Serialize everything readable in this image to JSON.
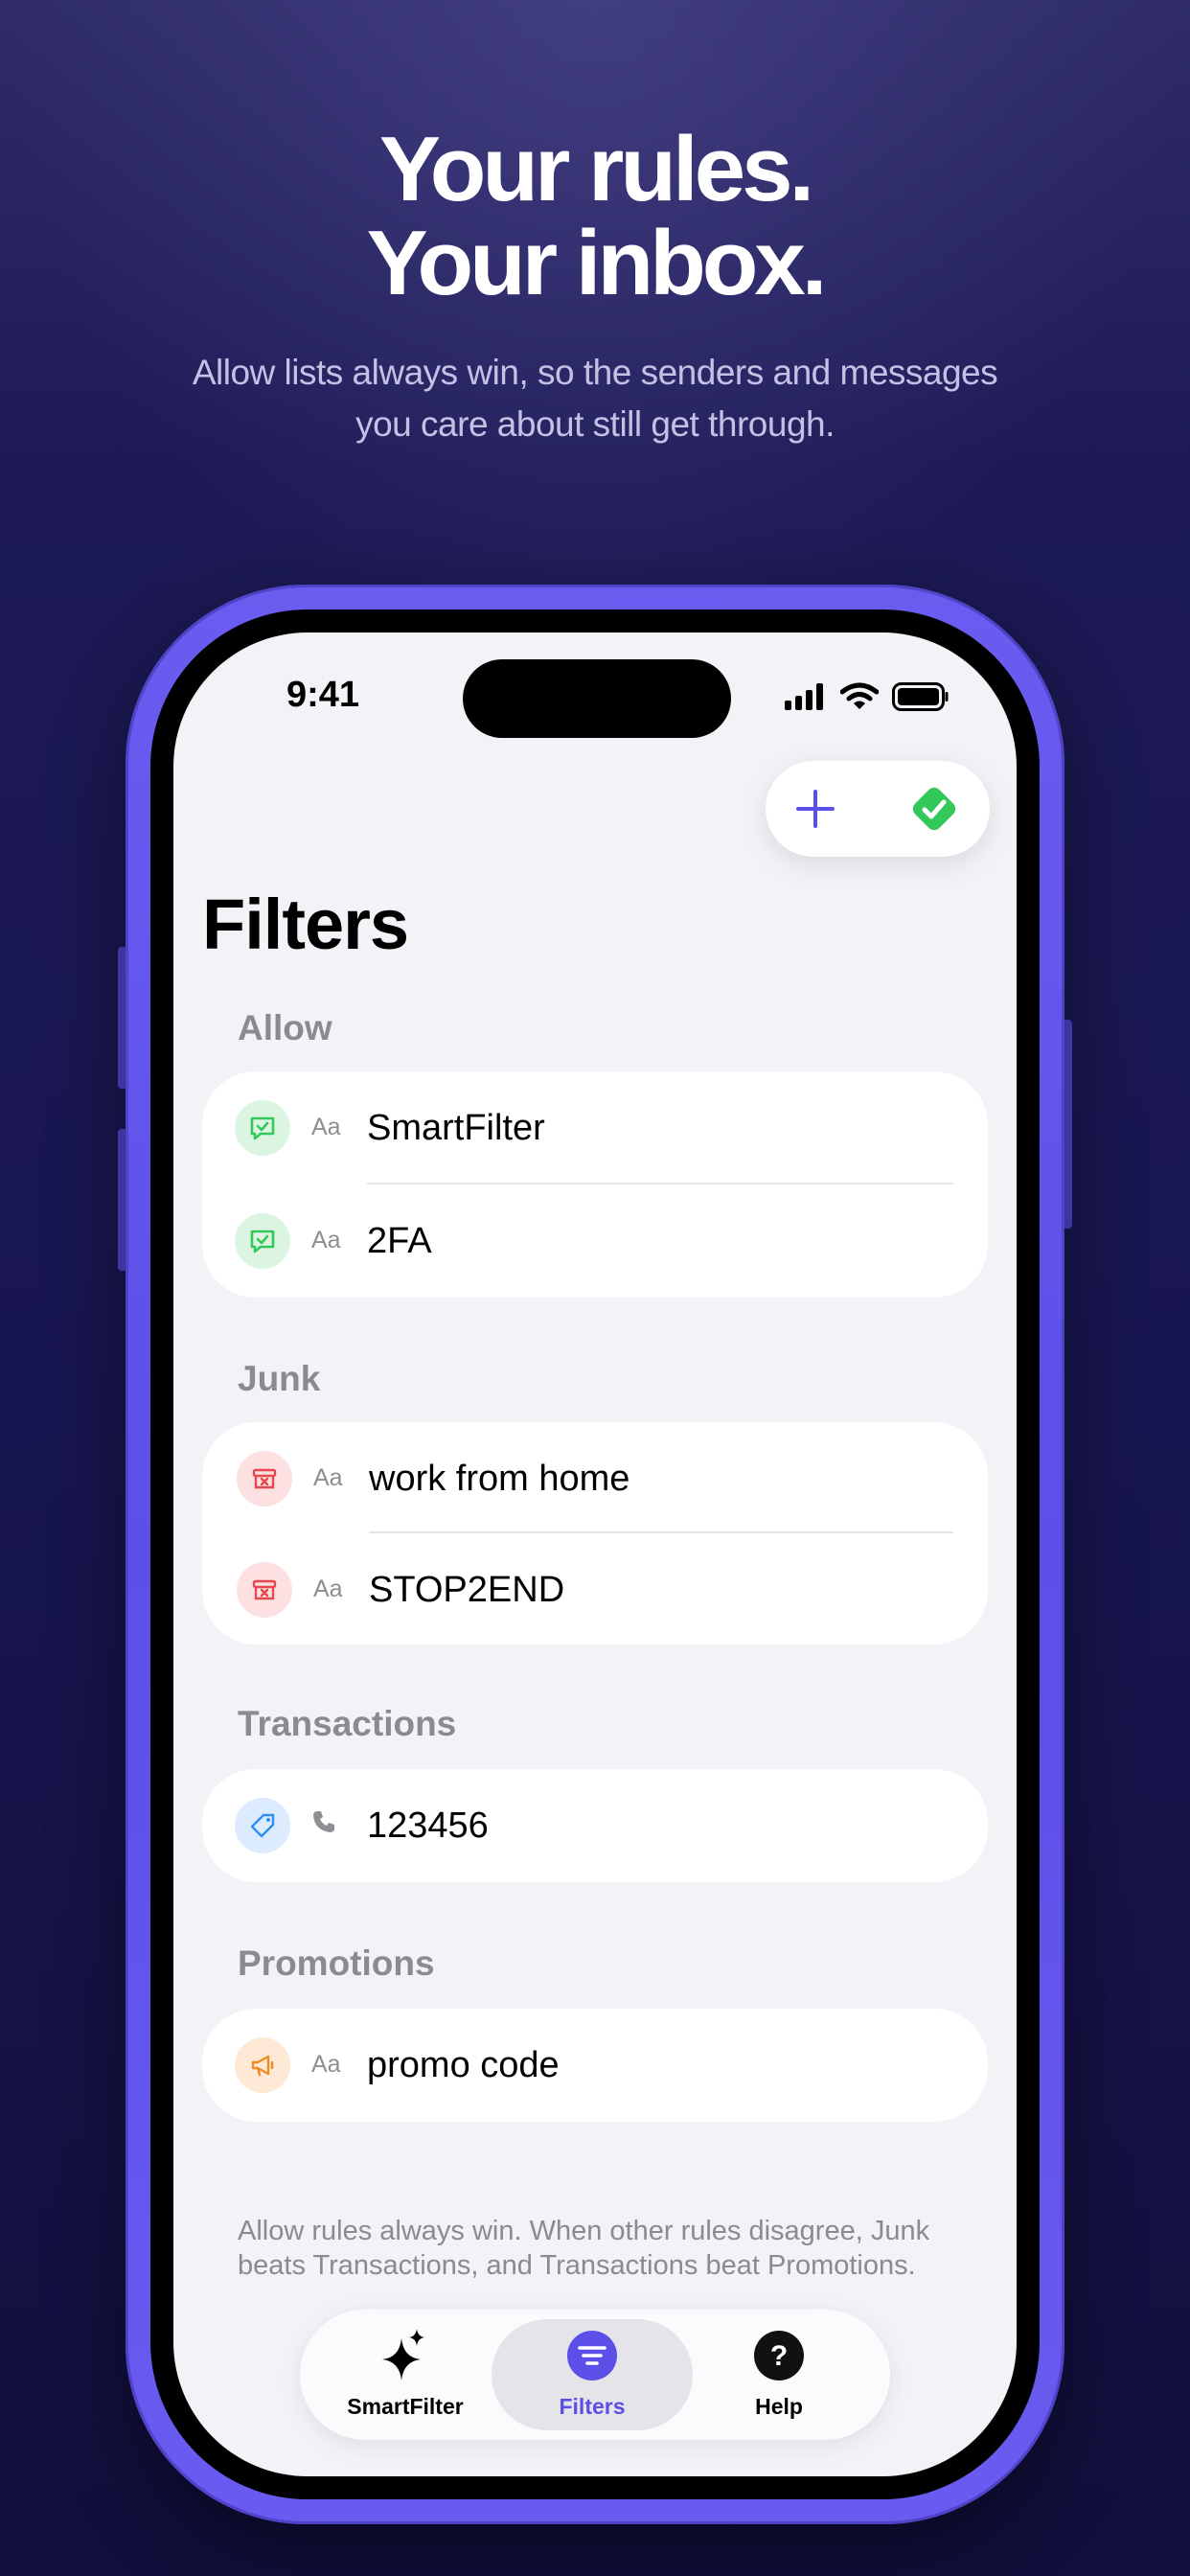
{
  "marketing": {
    "headline_line1": "Your rules.",
    "headline_line2": "Your inbox.",
    "subhead": "Allow lists always win, so the senders and messages you care about still get through."
  },
  "status_bar": {
    "time": "9:41"
  },
  "toolbar": {
    "add_icon": "plus-icon",
    "confirm_icon": "checkmark-diamond-icon"
  },
  "page": {
    "title": "Filters"
  },
  "sections": {
    "allow": {
      "label": "Allow",
      "rows": [
        {
          "type_label": "Aa",
          "text": "SmartFilter",
          "icon": "message-check-icon"
        },
        {
          "type_label": "Aa",
          "text": "2FA",
          "icon": "message-check-icon"
        }
      ]
    },
    "junk": {
      "label": "Junk",
      "rows": [
        {
          "type_label": "Aa",
          "text": "work from home",
          "icon": "archive-x-icon"
        },
        {
          "type_label": "Aa",
          "text": "STOP2END",
          "icon": "archive-x-icon"
        }
      ]
    },
    "transactions": {
      "label": "Transactions",
      "rows": [
        {
          "type_label": "phone",
          "text": "123456",
          "icon": "tag-icon"
        }
      ]
    },
    "promotions": {
      "label": "Promotions",
      "rows": [
        {
          "type_label": "Aa",
          "text": "promo code",
          "icon": "megaphone-icon"
        }
      ]
    }
  },
  "footnote": "Allow rules always win. When other rules disagree, Junk beats Transactions, and Transactions beat Promotions.",
  "tabbar": {
    "tabs": [
      {
        "label": "SmartFilter",
        "icon": "sparkles-icon"
      },
      {
        "label": "Filters",
        "icon": "filter-lines-icon",
        "selected": true
      },
      {
        "label": "Help",
        "icon": "question-circle-icon"
      }
    ]
  },
  "colors": {
    "accent": "#5b4fe8",
    "allow_green": "#34c759",
    "junk_red": "#e5484d",
    "transactions_blue": "#2f8ff0",
    "promotions_orange": "#f08a24",
    "background_top": "#2f2c69",
    "background_bottom": "#120f3c"
  }
}
